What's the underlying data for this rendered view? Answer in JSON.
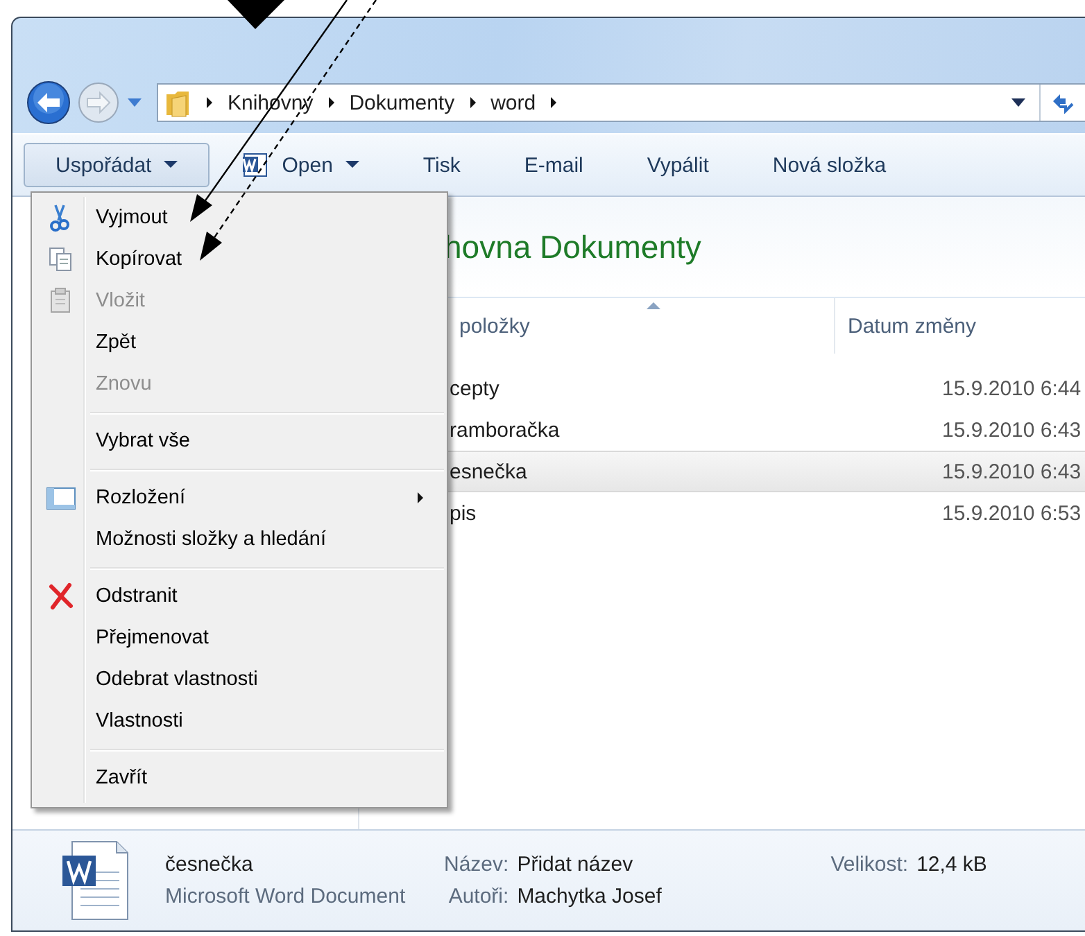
{
  "window": {
    "breadcrumb": [
      "Knihovny",
      "Dokumenty",
      "word"
    ]
  },
  "toolbar": [
    {
      "label": "Uspořádat",
      "dropdown": true,
      "pressed": true
    },
    {
      "label": "Open",
      "dropdown": true,
      "pressed": false
    },
    {
      "label": "Tisk",
      "dropdown": false,
      "pressed": false
    },
    {
      "label": "E-mail",
      "dropdown": false,
      "pressed": false
    },
    {
      "label": "Vypálit",
      "dropdown": false,
      "pressed": false
    },
    {
      "label": "Nová složka",
      "dropdown": false,
      "pressed": false
    }
  ],
  "context_menu": [
    {
      "kind": "item",
      "label": "Vyjmout",
      "disabled": false,
      "submenu": false
    },
    {
      "kind": "item",
      "label": "Kopírovat",
      "disabled": false,
      "submenu": false
    },
    {
      "kind": "item",
      "label": "Vložit",
      "disabled": true,
      "submenu": false
    },
    {
      "kind": "item",
      "label": "Zpět",
      "disabled": false,
      "submenu": false
    },
    {
      "kind": "item",
      "label": "Znovu",
      "disabled": true,
      "submenu": false
    },
    {
      "kind": "separator"
    },
    {
      "kind": "item",
      "label": "Vybrat vše",
      "disabled": false,
      "submenu": false
    },
    {
      "kind": "separator"
    },
    {
      "kind": "item",
      "label": "Rozložení",
      "disabled": false,
      "submenu": true
    },
    {
      "kind": "item",
      "label": "Možnosti složky a hledání",
      "disabled": false,
      "submenu": false
    },
    {
      "kind": "separator"
    },
    {
      "kind": "item",
      "label": "Odstranit",
      "disabled": false,
      "submenu": false
    },
    {
      "kind": "item",
      "label": "Přejmenovat",
      "disabled": false,
      "submenu": false
    },
    {
      "kind": "item",
      "label": "Odebrat vlastnosti",
      "disabled": false,
      "submenu": false
    },
    {
      "kind": "item",
      "label": "Vlastnosti",
      "disabled": false,
      "submenu": false
    },
    {
      "kind": "separator"
    },
    {
      "kind": "item",
      "label": "Zavřít",
      "disabled": false,
      "submenu": false
    }
  ],
  "library": {
    "heading": "hovna Dokumenty",
    "columns": [
      "položky",
      "Datum změny"
    ],
    "rows": [
      {
        "name": "cepty",
        "date": "15.9.2010 6:44",
        "selected": false
      },
      {
        "name": "ramboračka",
        "date": "15.9.2010 6:43",
        "selected": false
      },
      {
        "name": "esnečka",
        "date": "15.9.2010 6:43",
        "selected": true
      },
      {
        "name": "pis",
        "date": "15.9.2010 6:53",
        "selected": false
      }
    ]
  },
  "details": {
    "name": "česnečka",
    "type": "Microsoft Word Document",
    "fields": [
      {
        "label": "Název:",
        "value": "Přidat název"
      },
      {
        "label": "Autoři:",
        "value": "Machytka Josef"
      },
      {
        "label": "Velikost:",
        "value": "12,4 kB"
      }
    ]
  }
}
